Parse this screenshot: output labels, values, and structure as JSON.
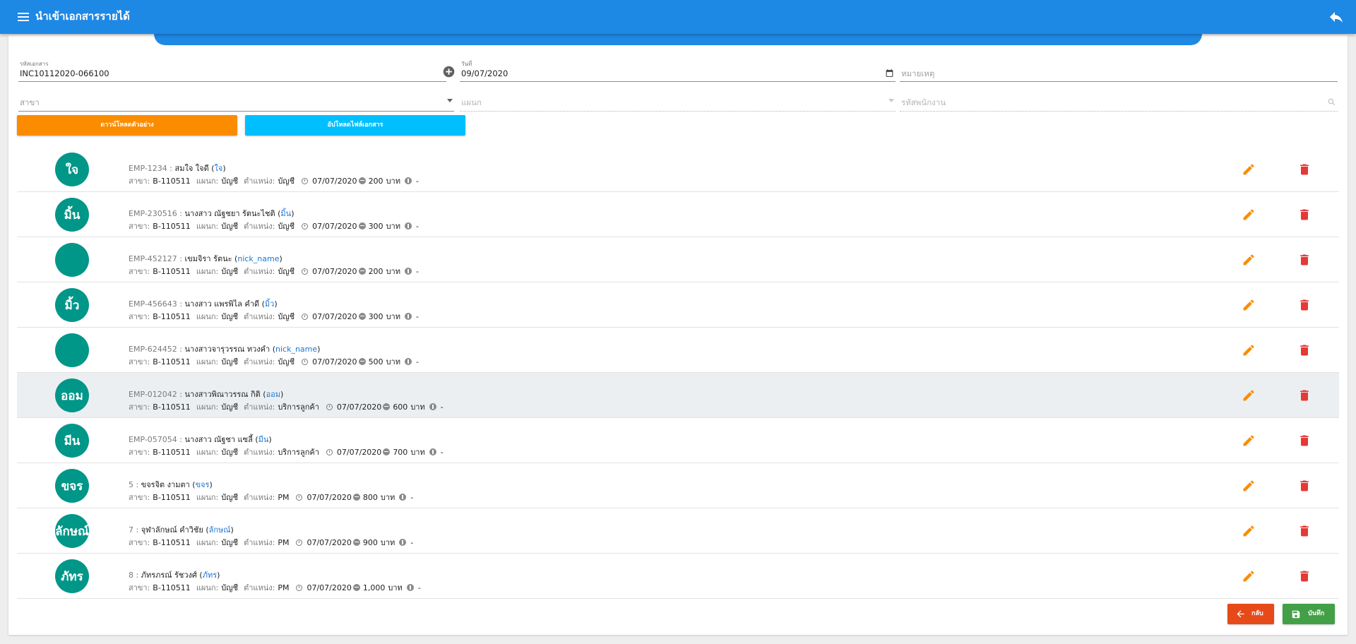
{
  "header": {
    "title": "นำเข้าเอกสารรายได้"
  },
  "form": {
    "doc_no": {
      "label": "รหัสเอกสาร",
      "value": "INC10112020-066100"
    },
    "date": {
      "label": "วันที่",
      "value": "09/07/2020"
    },
    "remark": {
      "placeholder": "หมายเหตุ"
    },
    "branch": {
      "placeholder": "สาขา"
    },
    "department": {
      "placeholder": "แผนก"
    },
    "employee_code": {
      "placeholder": "รหัสพนักงาน"
    }
  },
  "buttons": {
    "download_sample": "ดาวน์โหลดตัวอย่าง",
    "upload_file": "อัปโหลดไฟล์เอกสาร",
    "back": "กลับ",
    "save": "บันทึก"
  },
  "labels": {
    "branch": "สาขา:",
    "department": "แผนก:",
    "position": "ตำแหน่ง:",
    "currency": "บาท",
    "dash": "-"
  },
  "colors": {
    "primary": "#1e88e5",
    "avatar": "#009688",
    "edit": "#fb8c00",
    "delete": "#e53935"
  },
  "rows": [
    {
      "avatar": "ใจ",
      "code": "EMP-1234",
      "name": "สมใจ ใจดี",
      "nick": "ใจ",
      "branch": "B-110511",
      "department": "บัญชี",
      "position": "บัญชี",
      "date": "07/07/2020",
      "amount": "200"
    },
    {
      "avatar": "มิ้น",
      "code": "EMP-230516",
      "name": "นางสาว ณัฐชยา รัตนะไชติ",
      "nick": "มิ้น",
      "branch": "B-110511",
      "department": "บัญชี",
      "position": "บัญชี",
      "date": "07/07/2020",
      "amount": "300"
    },
    {
      "avatar": "",
      "code": "EMP-452127",
      "name": "เขมจิรา รัตนะ",
      "nick": "nick_name",
      "branch": "B-110511",
      "department": "บัญชี",
      "position": "บัญชี",
      "date": "07/07/2020",
      "amount": "200"
    },
    {
      "avatar": "มิ้ว",
      "code": "EMP-456643",
      "name": "นางสาว แพรพิไล คำดี",
      "nick": "มิ้ว",
      "branch": "B-110511",
      "department": "บัญชี",
      "position": "บัญชี",
      "date": "07/07/2020",
      "amount": "300"
    },
    {
      "avatar": "",
      "code": "EMP-624452",
      "name": "นางสาวจารุวรรณ ทวงคำ",
      "nick": "nick_name",
      "branch": "B-110511",
      "department": "บัญชี",
      "position": "บัญชี",
      "date": "07/07/2020",
      "amount": "500"
    },
    {
      "avatar": "ออม",
      "code": "EMP-012042",
      "name": "นางสาวพิณาวรรณ กิติ",
      "nick": "ออม",
      "branch": "B-110511",
      "department": "บัญชี",
      "position": "บริการลูกค้า",
      "date": "07/07/2020",
      "amount": "600"
    },
    {
      "avatar": "มีน",
      "code": "EMP-057054",
      "name": "นางสาว ณัฐชา แซลี้",
      "nick": "มีน",
      "branch": "B-110511",
      "department": "บัญชี",
      "position": "บริการลูกค้า",
      "date": "07/07/2020",
      "amount": "700"
    },
    {
      "avatar": "ขจร",
      "code": "5",
      "name": "ขจรจิต งามตา",
      "nick": "ขจร",
      "branch": "B-110511",
      "department": "บัญชี",
      "position": "PM",
      "date": "07/07/2020",
      "amount": "800"
    },
    {
      "avatar": "ลักษณ์",
      "code": "7",
      "name": "จุฬาลักษณ์ คำวิชัย",
      "nick": "ลักษณ์",
      "branch": "B-110511",
      "department": "บัญชี",
      "position": "PM",
      "date": "07/07/2020",
      "amount": "900"
    },
    {
      "avatar": "ภัทร",
      "code": "8",
      "name": "ภัทรภรณ์ รัชวงศ์",
      "nick": "ภัทร",
      "branch": "B-110511",
      "department": "บัญชี",
      "position": "PM",
      "date": "07/07/2020",
      "amount": "1,000"
    }
  ]
}
